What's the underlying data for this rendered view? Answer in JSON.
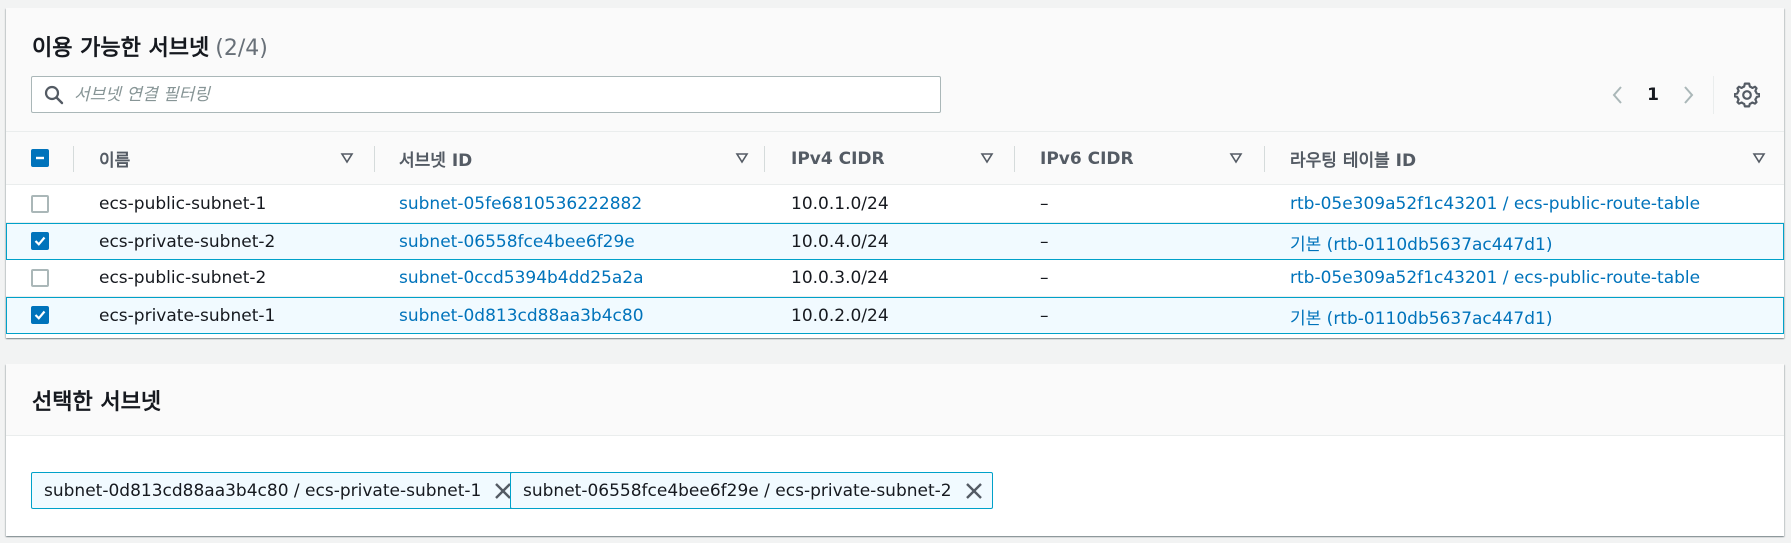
{
  "subnets_panel": {
    "title": "이용 가능한 서브넷",
    "count": "(2/4)",
    "filter_placeholder": "서브넷 연결 필터링",
    "pagination": {
      "current_page": "1"
    }
  },
  "table": {
    "columns": [
      "이름",
      "서브넷 ID",
      "IPv4 CIDR",
      "IPv6 CIDR",
      "라우팅 테이블 ID"
    ],
    "rows": [
      {
        "selected": false,
        "name": "ecs-public-subnet-1",
        "subnet_id": "subnet-05fe6810536222882",
        "ipv4": "10.0.1.0/24",
        "ipv6": "–",
        "route_table": "rtb-05e309a52f1c43201 / ecs-public-route-table"
      },
      {
        "selected": true,
        "name": "ecs-private-subnet-2",
        "subnet_id": "subnet-06558fce4bee6f29e",
        "ipv4": "10.0.4.0/24",
        "ipv6": "–",
        "route_table": "기본 (rtb-0110db5637ac447d1)"
      },
      {
        "selected": false,
        "name": "ecs-public-subnet-2",
        "subnet_id": "subnet-0ccd5394b4dd25a2a",
        "ipv4": "10.0.3.0/24",
        "ipv6": "–",
        "route_table": "rtb-05e309a52f1c43201 / ecs-public-route-table"
      },
      {
        "selected": true,
        "name": "ecs-private-subnet-1",
        "subnet_id": "subnet-0d813cd88aa3b4c80",
        "ipv4": "10.0.2.0/24",
        "ipv6": "–",
        "route_table": "기본 (rtb-0110db5637ac447d1)"
      }
    ]
  },
  "selected_panel": {
    "title": "선택한 서브넷",
    "tokens": [
      "subnet-0d813cd88aa3b4c80 / ecs-private-subnet-1",
      "subnet-06558fce4bee6f29e / ecs-private-subnet-2"
    ]
  },
  "colors": {
    "link": "#0073bb",
    "selected_row_bg": "#f1faff",
    "selected_border": "#00a1c9",
    "checkbox_on": "#0073bb"
  },
  "icons": [
    "search-icon",
    "chevron-left-icon",
    "chevron-right-icon",
    "gear-icon",
    "sort-down-icon",
    "close-icon",
    "checkmark-icon",
    "indeterminate-icon"
  ]
}
